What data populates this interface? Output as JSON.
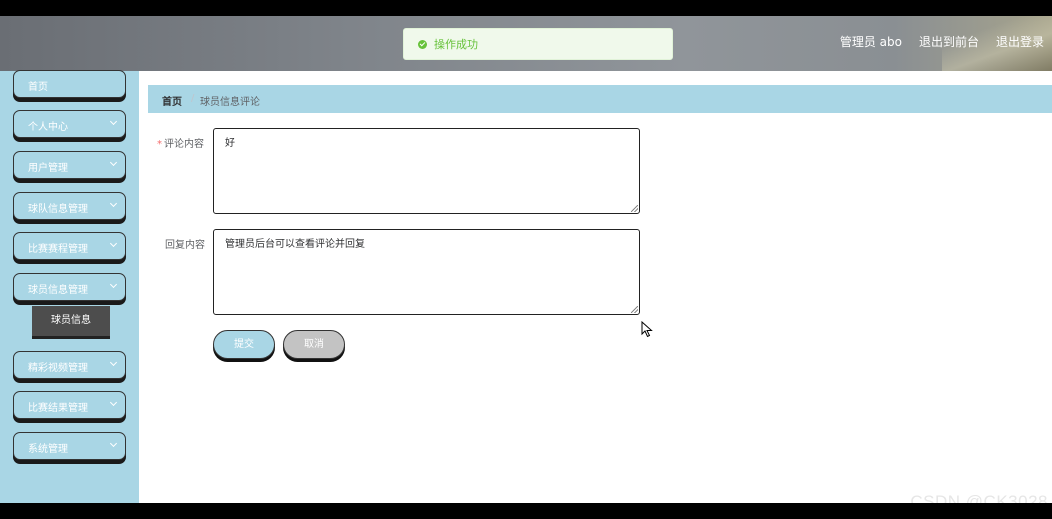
{
  "header": {
    "toast": {
      "message": "操作成功",
      "icon": "success-check-icon",
      "color": "#67c23a"
    },
    "user_label": "管理员 abo",
    "to_front_label": "退出到前台",
    "logout_label": "退出登录"
  },
  "sidebar": {
    "items": [
      {
        "label": "首页",
        "has_chevron": false
      },
      {
        "label": "个人中心",
        "has_chevron": true
      },
      {
        "label": "用户管理",
        "has_chevron": true
      },
      {
        "label": "球队信息管理",
        "has_chevron": true
      },
      {
        "label": "比赛赛程管理",
        "has_chevron": true
      },
      {
        "label": "球员信息管理",
        "has_chevron": true,
        "expanded": true
      },
      {
        "label": "精彩视频管理",
        "has_chevron": true
      },
      {
        "label": "比赛结果管理",
        "has_chevron": true
      },
      {
        "label": "系统管理",
        "has_chevron": true
      }
    ],
    "sub_item": {
      "label": "球员信息"
    }
  },
  "breadcrumb": {
    "home": "首页",
    "separator": "/",
    "current": "球员信息评论"
  },
  "form": {
    "comment": {
      "required_mark": "*",
      "label": "评论内容",
      "value": "好"
    },
    "reply": {
      "label": "回复内容",
      "value": "管理员后台可以查看评论并回复"
    },
    "submit_label": "提交",
    "cancel_label": "取消"
  },
  "watermark": "CSDN @CK3028",
  "colors": {
    "theme": "#a9d6e5",
    "cancel": "#c3c3c3",
    "required": "#f56c6c"
  }
}
